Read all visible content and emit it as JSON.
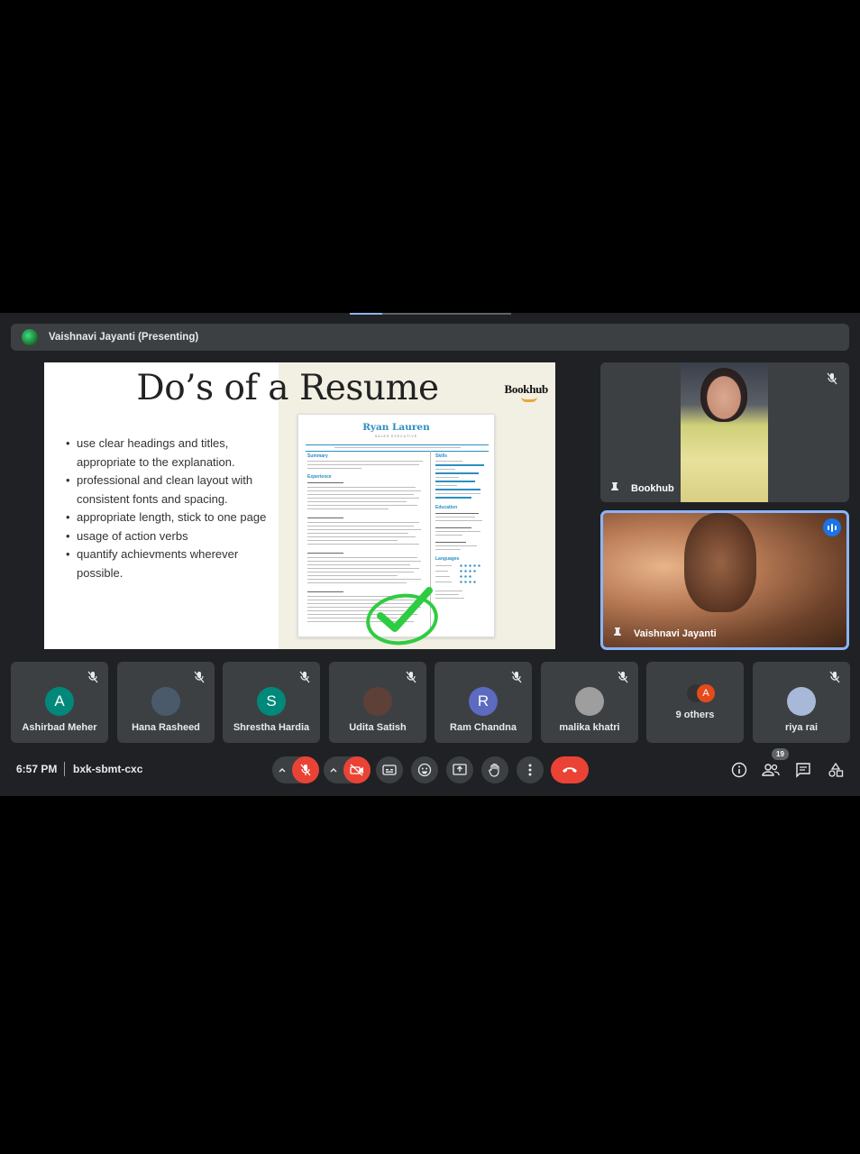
{
  "presentation": {
    "presenter_label": "Vaishnavi Jayanti (Presenting)",
    "progress_fraction": 0.2
  },
  "slide": {
    "title": "Do’s of a Resume",
    "brand": "Bookhub",
    "bullets": [
      "use clear headings and titles, appropriate to the explanation.",
      "professional and clean layout with consistent fonts and spacing.",
      "appropriate length, stick to one page",
      "usage of action verbs",
      "quantify achievments wherever possible."
    ],
    "resume": {
      "name": "Ryan Lauren",
      "title": "SALES EXECUTIVE",
      "left_headings": [
        "Summary",
        "Experience"
      ],
      "right_headings": [
        "Skills",
        "Education",
        "Languages"
      ]
    }
  },
  "tiles": {
    "bookhub": {
      "name": "Bookhub"
    },
    "vaishnavi": {
      "name": "Vaishnavi Jayanti"
    }
  },
  "participants": [
    {
      "name": "Ashirbad Meher",
      "initial": "A",
      "color": "#00897b"
    },
    {
      "name": "Hana Rasheed",
      "initial": "",
      "color": "#4a5a6a"
    },
    {
      "name": "Shrestha Hardia",
      "initial": "S",
      "color": "#00897b"
    },
    {
      "name": "Udita Satish",
      "initial": "",
      "color": "#5d4037"
    },
    {
      "name": "Ram Chandna",
      "initial": "R",
      "color": "#5c6bc0"
    },
    {
      "name": "malika khatri",
      "initial": "",
      "color": "#9e9e9e"
    },
    {
      "name": "9 others",
      "initial": "A",
      "color": "#e64a19"
    },
    {
      "name": "riya rai",
      "initial": "",
      "color": "#a8b8d8"
    }
  ],
  "bottom_bar": {
    "time": "6:57 PM",
    "meeting_code": "bxk-sbmt-cxc",
    "people_count": "19"
  },
  "colors": {
    "background": "#202124",
    "tile": "#3c4043",
    "danger": "#ea4335",
    "accent": "#8ab4f8"
  }
}
